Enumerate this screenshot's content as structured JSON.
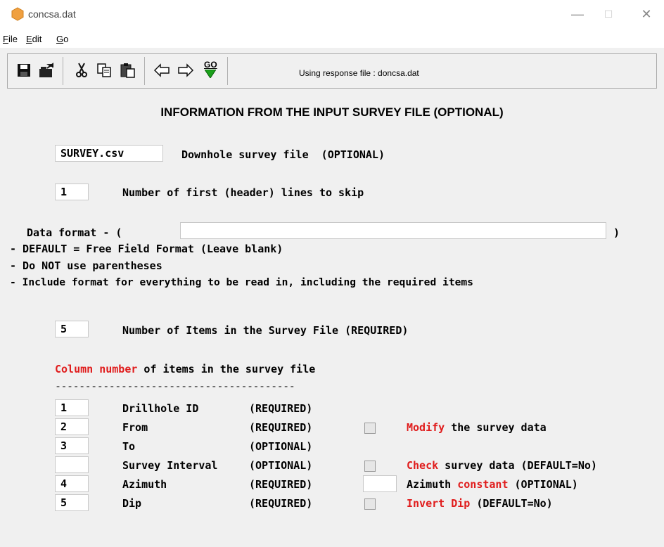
{
  "window": {
    "title": "concsa.dat",
    "minimize": "—",
    "maximize": "☐",
    "close": "✕"
  },
  "menu": {
    "file": {
      "mnemonic": "F",
      "rest": "ile"
    },
    "edit": {
      "mnemonic": "E",
      "rest": "dit"
    },
    "go": {
      "mnemonic": "G",
      "rest": "o"
    }
  },
  "toolbar": {
    "icons": [
      "save-icon",
      "open-icon",
      "cut-icon",
      "copy-icon",
      "paste-icon",
      "back-arrow-icon",
      "forward-arrow-icon",
      "go-icon"
    ],
    "go_label": "GO",
    "status_text": "Using response file : doncsa.dat"
  },
  "form": {
    "heading": "INFORMATION FROM THE INPUT SURVEY FILE (OPTIONAL)",
    "survey_file": {
      "value": "SURVEY.csv",
      "label": "Downhole survey file  (OPTIONAL)"
    },
    "header_lines": {
      "value": "1",
      "label": "Number of first (header) lines to skip"
    },
    "data_format": {
      "label": "Data format - (",
      "value": "",
      "close": ")",
      "notes": [
        "- DEFAULT = Free Field Format (Leave blank)",
        "- Do NOT use parentheses",
        "- Include format for everything to be read in, including the required items"
      ]
    },
    "num_items": {
      "value": "5",
      "label": "Number of Items in the Survey File (REQUIRED)"
    },
    "columns": {
      "label_red": "Column number",
      "label_rest": " of items in the survey file",
      "separator": "----------------------------------------",
      "rows": [
        {
          "value": "1",
          "name": "Drillhole ID",
          "req": "(REQUIRED)"
        },
        {
          "value": "2",
          "name": "From",
          "req": "(REQUIRED)"
        },
        {
          "value": "3",
          "name": "To",
          "req": "(OPTIONAL)"
        },
        {
          "value": "",
          "name": "Survey Interval",
          "req": "(OPTIONAL)"
        },
        {
          "value": "4",
          "name": "Azimuth",
          "req": "(REQUIRED)"
        },
        {
          "value": "5",
          "name": "Dip",
          "req": "(REQUIRED)"
        }
      ]
    },
    "options": {
      "modify": {
        "red": "Modify",
        "rest": " the survey data",
        "checked": false
      },
      "check": {
        "red": "Check",
        "rest": " survey data (DEFAULT=No)",
        "checked": false
      },
      "azimuth": {
        "value": "",
        "pre": "Azimuth ",
        "red": "constant",
        "rest": " (OPTIONAL)"
      },
      "invert": {
        "red": "Invert Dip",
        "rest": " (DEFAULT=No)",
        "checked": false
      }
    }
  },
  "colors": {
    "accent_red": "#e01c1c",
    "app_icon": "#f0a040"
  }
}
